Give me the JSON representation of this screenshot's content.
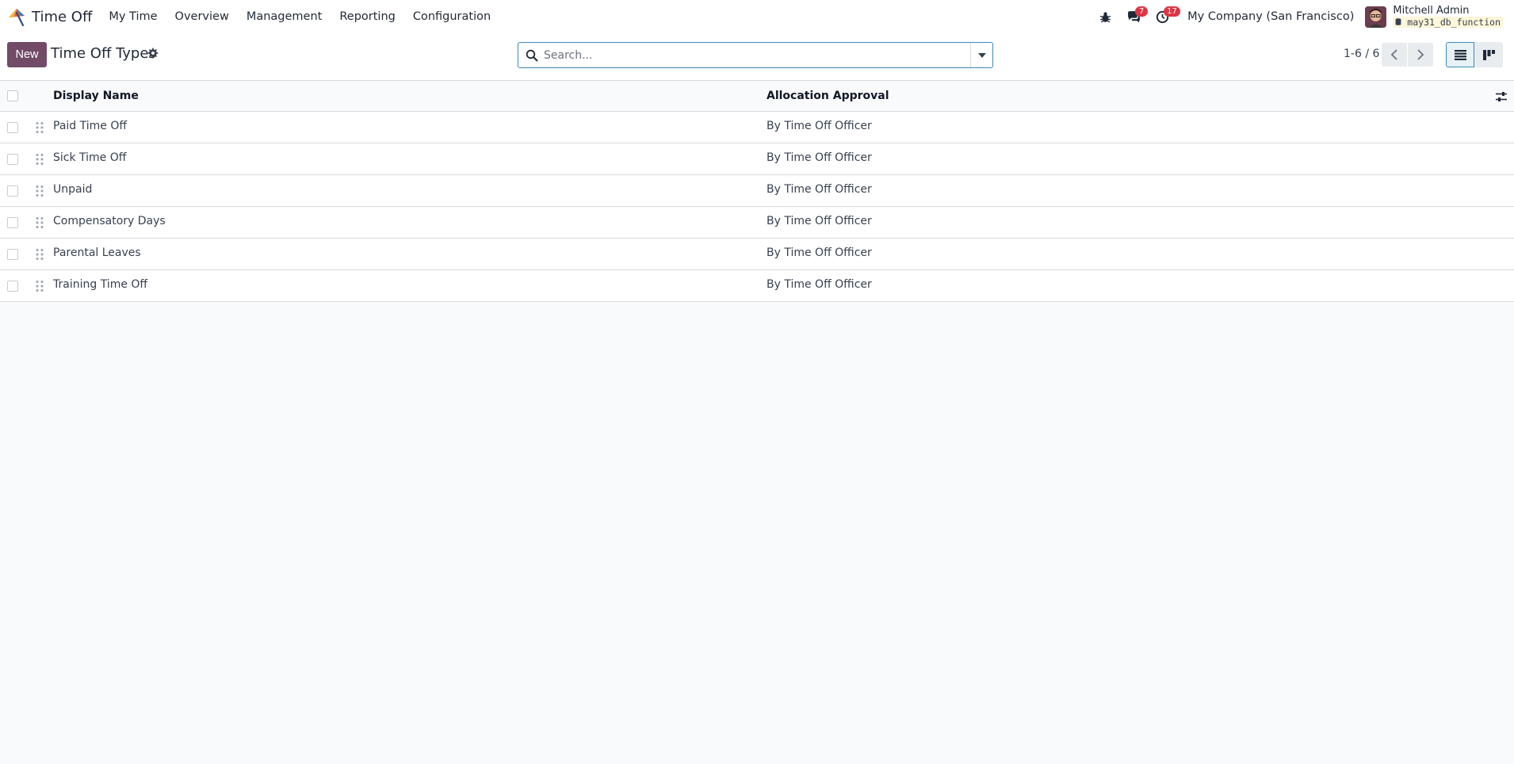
{
  "navbar": {
    "app_name": "Time Off",
    "menu": [
      "My Time",
      "Overview",
      "Management",
      "Reporting",
      "Configuration"
    ],
    "messages_badge": "7",
    "activities_badge": "17",
    "company": "My Company (San Francisco)",
    "user_name": "Mitchell Admin",
    "database": "may31_db_function"
  },
  "control": {
    "new_label": "New",
    "title": "Time Off Types",
    "search_placeholder": "Search...",
    "pager": "1-6 / 6"
  },
  "table": {
    "columns": [
      "Display Name",
      "Allocation Approval"
    ],
    "rows": [
      {
        "name": "Paid Time Off",
        "approval": "By Time Off Officer"
      },
      {
        "name": "Sick Time Off",
        "approval": "By Time Off Officer"
      },
      {
        "name": "Unpaid",
        "approval": "By Time Off Officer"
      },
      {
        "name": "Compensatory Days",
        "approval": "By Time Off Officer"
      },
      {
        "name": "Parental Leaves",
        "approval": "By Time Off Officer"
      },
      {
        "name": "Training Time Off",
        "approval": "By Time Off Officer"
      }
    ]
  },
  "colors": {
    "primary": "#714b67",
    "badge": "#dc3545",
    "focus": "#3c8ab8"
  }
}
